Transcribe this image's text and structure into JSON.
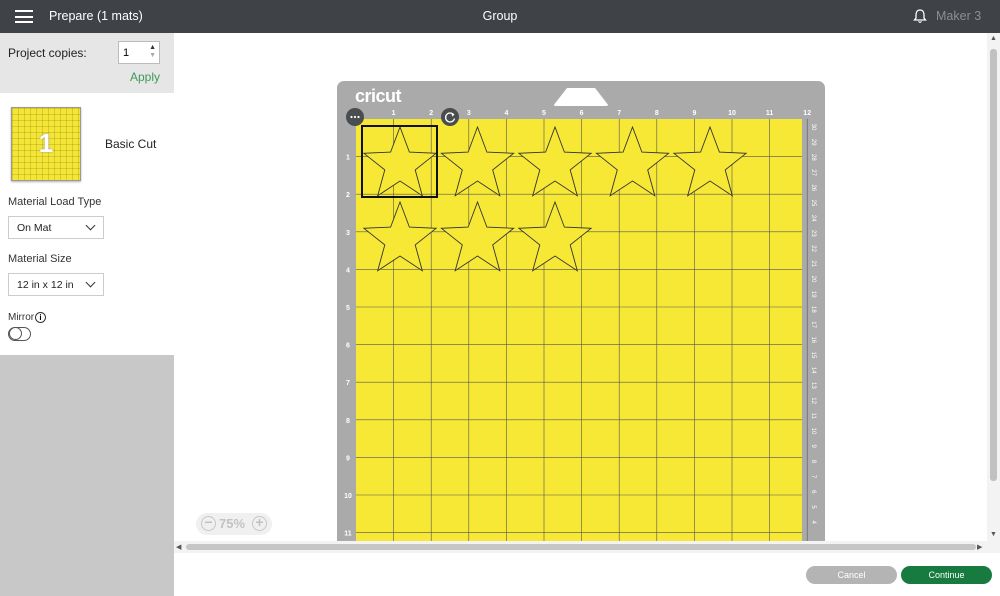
{
  "header": {
    "title": "Prepare (1 mats)",
    "center_title": "Group",
    "machine": "Maker 3"
  },
  "sidebar": {
    "copies_label": "Project copies:",
    "copies_value": "1",
    "apply_label": "Apply",
    "mat": {
      "number": "1",
      "name": "Basic Cut"
    },
    "load_type_label": "Material Load Type",
    "load_type_value": "On Mat",
    "size_label": "Material Size",
    "size_value": "12 in x 12 in",
    "mirror_label": "Mirror",
    "mirror_on": false
  },
  "mat": {
    "logo": "cricut",
    "color": "#f6e835",
    "top_ruler": [
      "1",
      "2",
      "3",
      "4",
      "5",
      "6",
      "7",
      "8",
      "9",
      "10",
      "11",
      "12"
    ],
    "left_ruler": [
      "1",
      "2",
      "3",
      "4",
      "5",
      "6",
      "7",
      "8",
      "9",
      "10",
      "11"
    ],
    "right_ruler": [
      "30",
      "29",
      "28",
      "27",
      "26",
      "25",
      "24",
      "23",
      "22",
      "21",
      "20",
      "19",
      "18",
      "17",
      "16",
      "15",
      "14",
      "13",
      "12",
      "11",
      "10",
      "9",
      "8",
      "7",
      "6",
      "5",
      "4"
    ],
    "stars": [
      {
        "col": 0,
        "row": 0
      },
      {
        "col": 1,
        "row": 0
      },
      {
        "col": 2,
        "row": 0
      },
      {
        "col": 3,
        "row": 0
      },
      {
        "col": 4,
        "row": 0
      },
      {
        "col": 0,
        "row": 1
      },
      {
        "col": 1,
        "row": 1
      },
      {
        "col": 2,
        "row": 1
      }
    ],
    "selected_star": 0
  },
  "zoom": {
    "level": "75%"
  },
  "footer": {
    "cancel_label": "Cancel",
    "continue_label": "Continue"
  },
  "colors": {
    "topbar": "#3f4347",
    "accent_green": "#177a3f",
    "apply_green": "#3d9a59",
    "mat_yellow": "#f6e835"
  }
}
